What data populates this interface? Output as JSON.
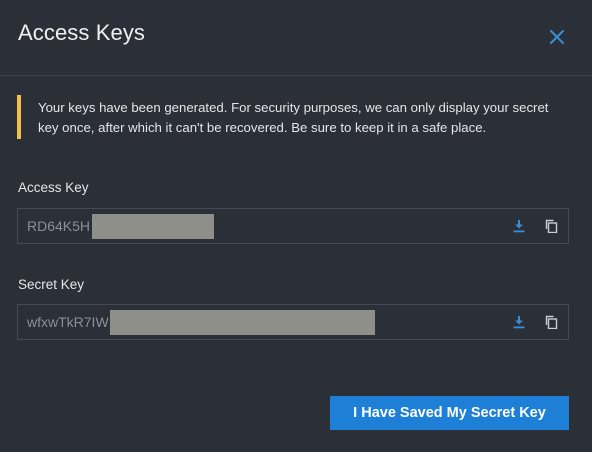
{
  "dialog": {
    "title": "Access Keys",
    "close_icon": "close-icon"
  },
  "notice": {
    "text": "Your keys have been generated. For security purposes, we can only display your secret key once, after which it can't be recovered. Be sure to keep it in a safe place.",
    "accent_color": "#f2c14b"
  },
  "access_key": {
    "label": "Access Key",
    "visible_value": "RD64K5H",
    "redacted": true,
    "download_icon": "download-icon",
    "copy_icon": "copy-icon"
  },
  "secret_key": {
    "label": "Secret Key",
    "visible_value": "wfxwTkR7IW",
    "redacted": true,
    "download_icon": "download-icon",
    "copy_icon": "copy-icon"
  },
  "actions": {
    "confirm_label": "I Have Saved My Secret Key"
  },
  "colors": {
    "background": "#2b2f38",
    "primary": "#1d80d6",
    "icon_blue": "#3a8fd9",
    "icon_gray": "#c9ccd2",
    "redaction": "#8e8e8b"
  }
}
